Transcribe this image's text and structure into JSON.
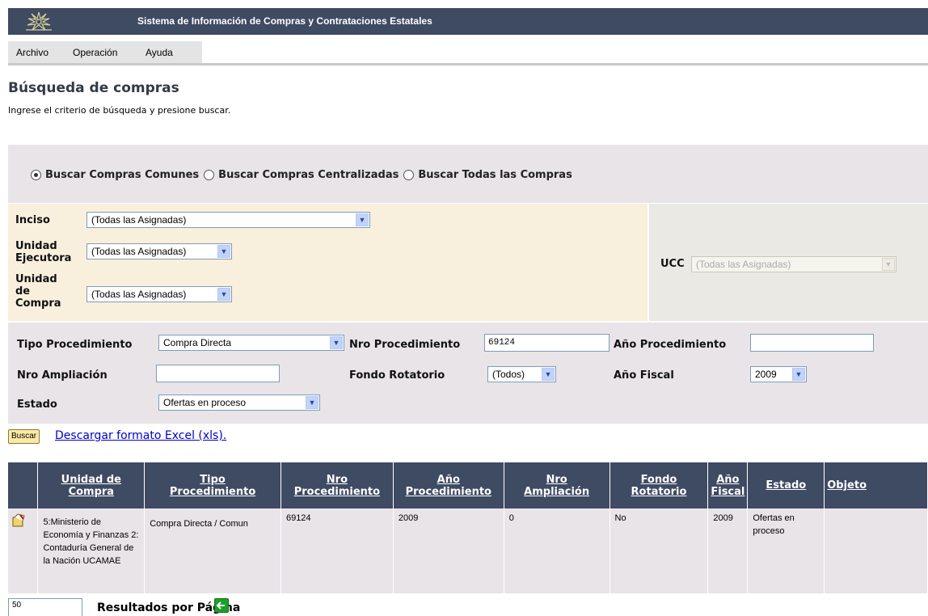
{
  "header": {
    "title": "Sistema de Información de Compras y Contrataciones Estatales"
  },
  "menu": [
    "Archivo",
    "Operación",
    "Ayuda"
  ],
  "page": {
    "title": "Búsqueda de compras",
    "subtitle": "Ingrese el criterio de búsqueda y presione buscar."
  },
  "search_mode": {
    "options": [
      "Buscar Compras Comunes",
      "Buscar Compras Centralizadas",
      "Buscar Todas las Compras"
    ],
    "selected": "Buscar Compras Comunes"
  },
  "filters": {
    "inciso": {
      "label": "Inciso",
      "value": "(Todas las Asignadas)"
    },
    "unidad_ejecutora": {
      "label_1": "Unidad",
      "label_2": "Ejecutora",
      "value": "(Todas las Asignadas)"
    },
    "unidad_compra": {
      "label_1": "Unidad",
      "label_2": "de",
      "label_3": "Compra",
      "value": "(Todas las Asignadas)"
    },
    "ucc": {
      "label": "UCC",
      "value": "(Todas las Asignadas)"
    },
    "tipo_procedimiento": {
      "label": "Tipo Procedimiento",
      "value": "Compra Directa"
    },
    "nro_procedimiento": {
      "label": "Nro Procedimiento",
      "value": "69124"
    },
    "anio_procedimiento": {
      "label": "Año Procedimiento",
      "value": ""
    },
    "nro_ampliacion": {
      "label": "Nro Ampliación",
      "value": ""
    },
    "fondo_rotatorio": {
      "label": "Fondo Rotatorio",
      "value": "(Todos)"
    },
    "anio_fiscal": {
      "label": "Año Fiscal",
      "value": "2009"
    },
    "estado": {
      "label": "Estado",
      "value": "Ofertas en proceso"
    }
  },
  "actions": {
    "buscar_label": "Buscar",
    "excel_link": "Descargar formato Excel (xls)."
  },
  "results": {
    "columns": [
      {
        "line1": "Unidad de",
        "line2": "Compra"
      },
      {
        "line1": "Tipo",
        "line2": "Procedimiento"
      },
      {
        "line1": "Nro",
        "line2": "Procedimiento"
      },
      {
        "line1": "Año",
        "line2": "Procedimiento"
      },
      {
        "line1": "Nro",
        "line2": "Ampliación"
      },
      {
        "line1": "Fondo",
        "line2": "Rotatorio"
      },
      {
        "line1": "Año",
        "line2": "Fiscal"
      },
      {
        "line1": "Estado",
        "line2": ""
      },
      {
        "line1": "Objeto",
        "line2": ""
      }
    ],
    "rows": [
      {
        "unidad_compra": "5:Ministerio de Economía y Finanzas 2: Contaduría General de la Nación UCAMAE",
        "tipo_procedimiento": "Compra Directa / Comun",
        "nro_procedimiento": "69124",
        "anio_procedimiento": "2009",
        "nro_ampliacion": "0",
        "fondo_rotatorio": "No",
        "anio_fiscal": "2009",
        "estado": "Ofertas en proceso",
        "objeto": ""
      }
    ]
  },
  "pagination": {
    "per_page_value": "50",
    "per_page_label": "Resultados por Página"
  },
  "colors": {
    "header_bg": "#3f4a63",
    "panel_gray": "#e8e4e8",
    "panel_beige": "#f8efdd",
    "link": "#0000cc",
    "back_icon": "#1e9e2a"
  },
  "icons": [
    "logo-icon",
    "view-detail-icon",
    "back-arrow-icon"
  ]
}
